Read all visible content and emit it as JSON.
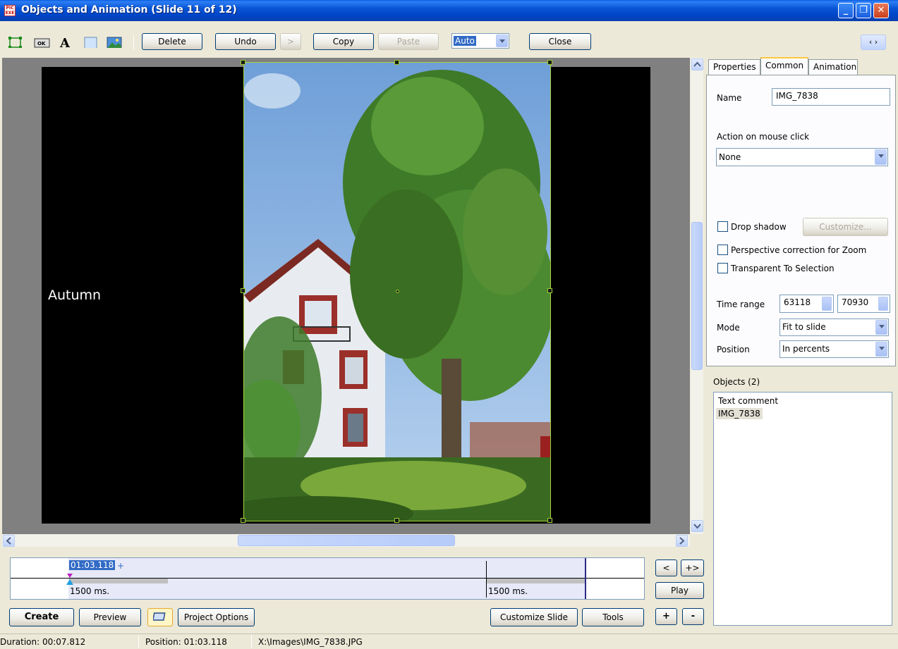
{
  "window": {
    "title": "Objects and Animation  (Slide 11 of 12)",
    "app_icon_text": "PIC EXE"
  },
  "toolbar": {
    "delete": "Delete",
    "undo": "Undo",
    "redo": ">",
    "copy": "Copy",
    "paste": "Paste",
    "zoom_value": "Auto",
    "close": "Close",
    "nav_arrows": "‹ ›"
  },
  "slide": {
    "text_object": "Autumn"
  },
  "tabs": {
    "properties": "Properties",
    "common": "Common",
    "animation": "Animation"
  },
  "common": {
    "name_label": "Name",
    "name_value": "IMG_7838",
    "action_label": "Action on mouse click",
    "action_value": "None",
    "drop_shadow": "Drop shadow",
    "customize": "Customize...",
    "perspective": "Perspective correction for Zoom",
    "transparent": "Transparent To Selection",
    "time_range_label": "Time range",
    "time_start": "63118",
    "time_end": "70930",
    "mode_label": "Mode",
    "mode_value": "Fit to slide",
    "position_label": "Position",
    "position_value": "In percents"
  },
  "objects": {
    "title": "Objects (2)",
    "items": [
      "Text comment",
      "IMG_7838"
    ]
  },
  "timeline": {
    "current_time": "01:03.118",
    "plus_marker": "+",
    "left_duration": "1500 ms.",
    "right_duration": "1500 ms.",
    "prev": "<",
    "next": "+>",
    "play": "Play",
    "add": "+",
    "remove": "-"
  },
  "bottom": {
    "create": "Create",
    "preview": "Preview",
    "project_options": "Project Options",
    "customize_slide": "Customize Slide",
    "tools": "Tools"
  },
  "status": {
    "duration": "Duration:  00:07.812",
    "position": "Position:  01:03.118",
    "path": "X:\\Images\\IMG_7838.JPG"
  }
}
